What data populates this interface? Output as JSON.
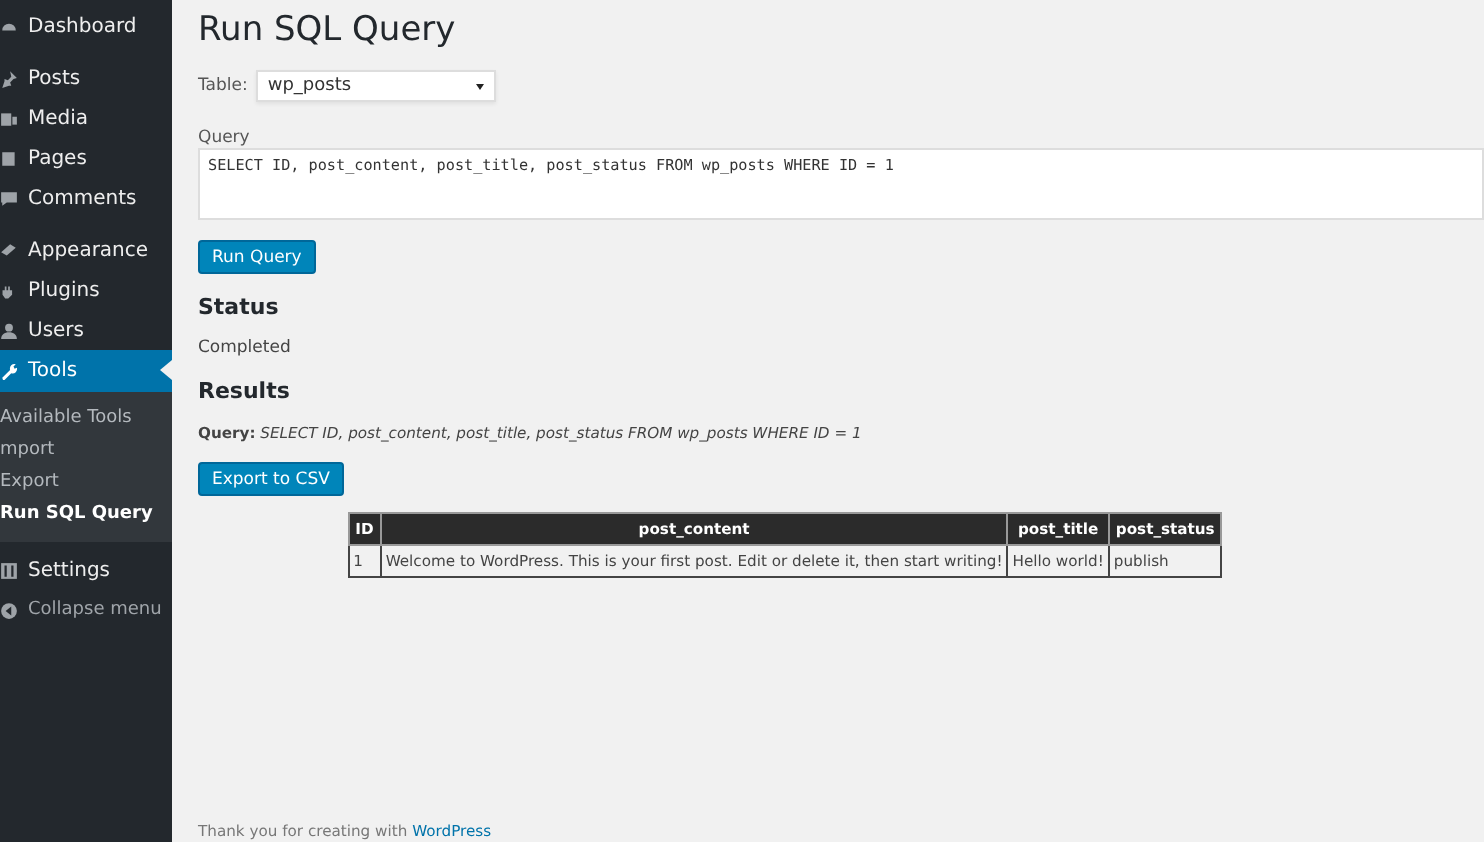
{
  "sidebar": {
    "groups": [
      [
        {
          "label": "Dashboard",
          "selected": false
        }
      ],
      [
        {
          "label": "Posts",
          "selected": false
        },
        {
          "label": "Media",
          "selected": false
        },
        {
          "label": "Pages",
          "selected": false
        },
        {
          "label": "Comments",
          "selected": false
        }
      ],
      [
        {
          "label": "Appearance",
          "selected": false
        },
        {
          "label": "Plugins",
          "selected": false
        },
        {
          "label": "Users",
          "selected": false
        },
        {
          "label": "Tools",
          "selected": true,
          "children": [
            {
              "label": "Available Tools",
              "selected": false
            },
            {
              "label": "mport",
              "selected": false
            },
            {
              "label": "Export",
              "selected": false
            },
            {
              "label": "Run SQL Query",
              "selected": true
            }
          ]
        },
        {
          "label": "Settings",
          "selected": false
        }
      ]
    ],
    "collapse": "Collapse menu"
  },
  "page": {
    "title": "Run SQL Query",
    "table_label": "Table:",
    "table_value": "wp_posts",
    "query_label": "Query",
    "query_value": "SELECT ID, post_content, post_title, post_status FROM wp_posts WHERE ID = 1",
    "run_button": "Run Query",
    "status_heading": "Status",
    "status": "Completed",
    "results_heading": "Results",
    "results_query": "**Query:** *SELECT ID, post_content, post_title, post_status FROM wp_posts WHERE ID = 1*",
    "export_button": "Export to CSV"
  },
  "table": {
    "columns": [
      "ID",
      "post_content",
      "post_title",
      "post_status"
    ],
    "rows": [
      [
        "1",
        "Welcome to WordPress. This is your first post. Edit or delete it, then start writing!",
        "Hello world!",
        "publish"
      ]
    ]
  },
  "footer": {
    "text": "Thank you for creating with ",
    "link": "WordPress"
  }
}
